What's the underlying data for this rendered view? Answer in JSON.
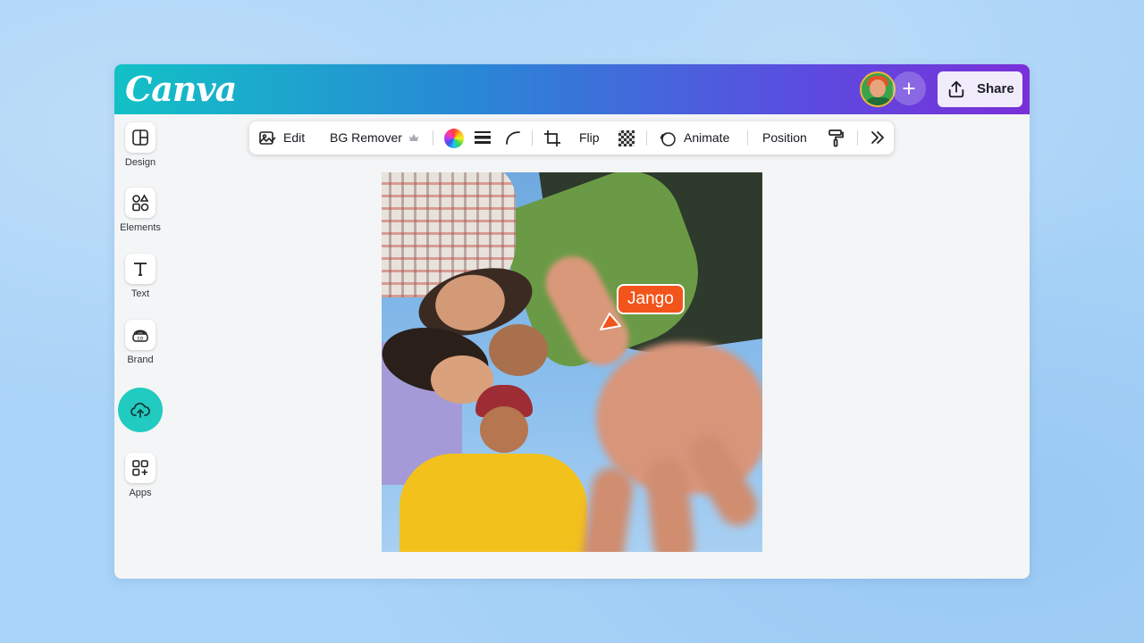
{
  "app": {
    "logo_text": "Canva",
    "brand_gradient": [
      "#12c1c6",
      "#2a86d6",
      "#5b4ce0",
      "#7a2fd8"
    ]
  },
  "header": {
    "add_label": "+",
    "share_label": "Share"
  },
  "sidebar": {
    "items": [
      {
        "label": "Design",
        "icon": "layout-icon"
      },
      {
        "label": "Elements",
        "icon": "shapes-icon"
      },
      {
        "label": "Text",
        "icon": "text-icon"
      },
      {
        "label": "Brand",
        "icon": "brand-icon"
      },
      {
        "label": "",
        "icon": "cloud-upload-icon",
        "active": true
      },
      {
        "label": "Apps",
        "icon": "apps-icon"
      }
    ],
    "accent": "#21cbc0"
  },
  "toolbar": {
    "edit_label": "Edit",
    "bg_remover_label": "BG Remover",
    "flip_label": "Flip",
    "animate_label": "Animate",
    "position_label": "Position"
  },
  "canvas": {
    "collaborator_name": "Jango",
    "collaborator_color": "#f2541b"
  }
}
